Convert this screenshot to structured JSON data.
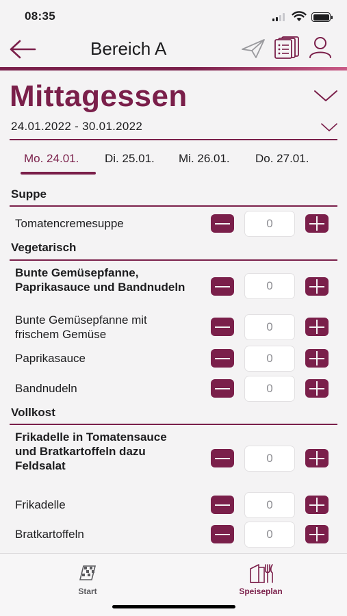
{
  "status_bar": {
    "time": "08:35"
  },
  "header": {
    "title": "Bereich A",
    "back_icon": "arrow-left-icon",
    "icons": [
      "paper-plane-icon",
      "documents-list-icon",
      "user-icon"
    ]
  },
  "colors": {
    "accent": "#7a1f4a",
    "background": "#f4f3f4",
    "header_gradient_end": "#c95a86"
  },
  "meal": {
    "title": "Mittagessen",
    "week_range": "24.01.2022 - 30.01.2022"
  },
  "days": [
    {
      "label": "Mo. 24.01.",
      "active": true
    },
    {
      "label": "Di. 25.01.",
      "active": false
    },
    {
      "label": "Mi. 26.01.",
      "active": false
    },
    {
      "label": "Do. 27.01.",
      "active": false
    }
  ],
  "sections": [
    {
      "title": "Suppe",
      "items": [
        {
          "label": "Tomatencremesuppe",
          "bold": false,
          "qty": "0"
        }
      ]
    },
    {
      "title": "Vegetarisch",
      "items": [
        {
          "label": "Bunte Gemüsepfanne, Paprikasauce und Bandnudeln",
          "bold": true,
          "qty": "0"
        },
        {
          "label": "Bunte Gemüsepfanne mit frischem Gemüse",
          "bold": false,
          "qty": "0"
        },
        {
          "label": "Paprikasauce",
          "bold": false,
          "qty": "0"
        },
        {
          "label": "Bandnudeln",
          "bold": false,
          "qty": "0"
        }
      ]
    },
    {
      "title": "Vollkost",
      "items": [
        {
          "label": "Frikadelle in Tomatensauce und Bratkartoffeln dazu Feldsalat",
          "bold": true,
          "qty": "0"
        },
        {
          "label": "Frikadelle",
          "bold": false,
          "qty": "0"
        },
        {
          "label": "Bratkartoffeln",
          "bold": false,
          "qty": "0"
        }
      ]
    }
  ],
  "bottom_nav": [
    {
      "label": "Start",
      "icon": "start-flag-icon",
      "active": false
    },
    {
      "label": "Speiseplan",
      "icon": "menu-cutlery-icon",
      "active": true
    }
  ]
}
